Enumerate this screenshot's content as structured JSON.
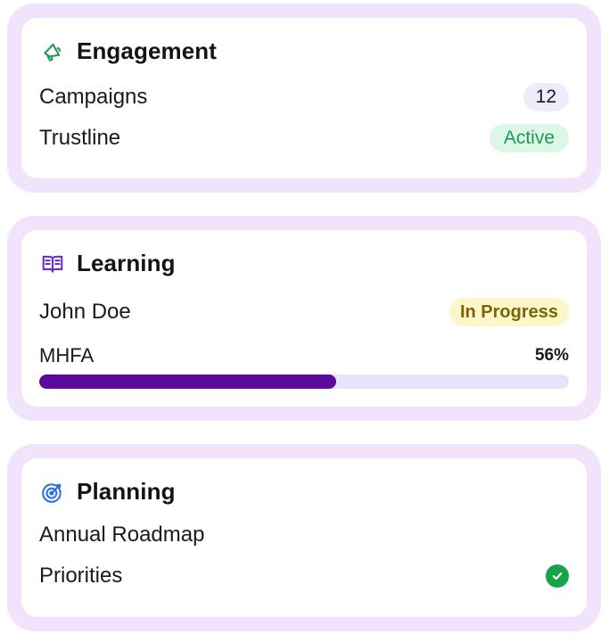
{
  "cards": [
    {
      "title": "Engagement",
      "icon": "megaphone-icon",
      "rows": [
        {
          "label": "Campaigns",
          "badge": "12"
        },
        {
          "label": "Trustline",
          "badge": "Active"
        }
      ]
    },
    {
      "title": "Learning",
      "icon": "open-book-icon",
      "person": "John Doe",
      "status": "In Progress",
      "course": "MHFA",
      "progress_label": "56%",
      "progress_fraction": 0.56
    },
    {
      "title": "Planning",
      "icon": "target-icon",
      "rows": [
        {
          "label": "Annual Roadmap"
        },
        {
          "label": "Priorities",
          "status_icon": "check-circle-icon"
        }
      ]
    }
  ],
  "colors": {
    "card_border": "#f1e3fb",
    "active_green": "#1f9a55",
    "progress_fill": "#5b089c",
    "progress_track": "#e6e3fa",
    "in_progress_bg": "#fdf6c8",
    "check_green": "#16a34a"
  }
}
